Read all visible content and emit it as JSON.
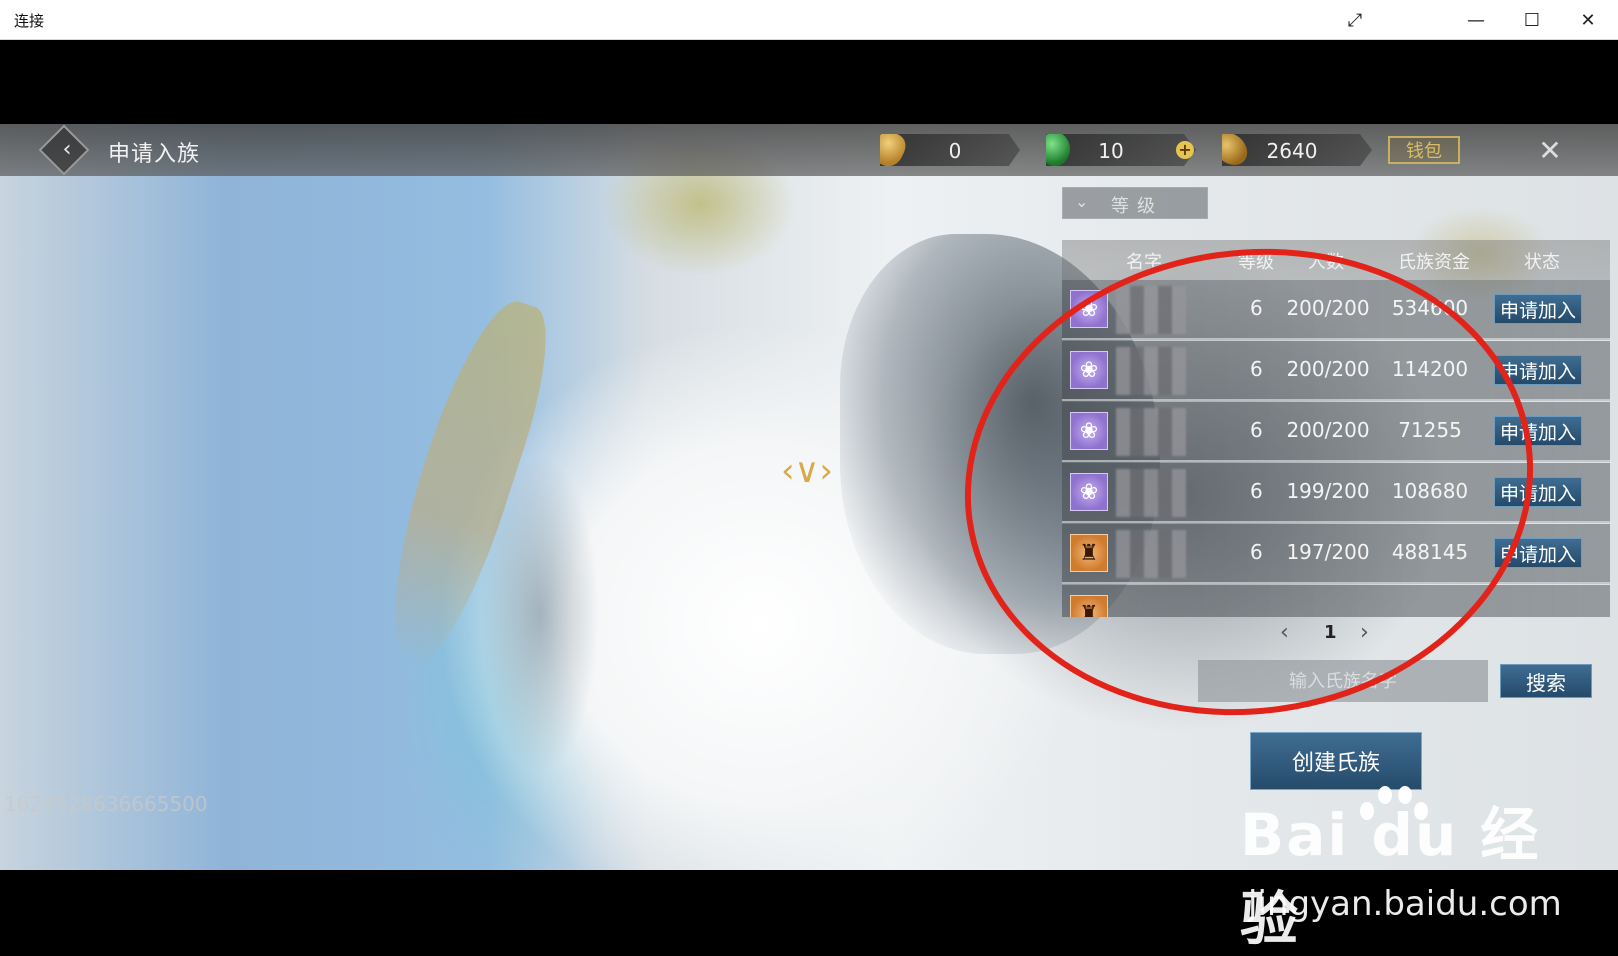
{
  "window": {
    "title": "连接"
  },
  "game": {
    "page_title": "申请入族",
    "resources": [
      {
        "icon": "gold-bell-icon",
        "value": "0"
      },
      {
        "icon": "jade-coin-icon",
        "value": "10"
      },
      {
        "icon": "copper-coin-icon",
        "value": "2640"
      }
    ],
    "wallet_label": "钱包",
    "level_filter": "等级",
    "table": {
      "headers": {
        "name": "名字",
        "level": "等级",
        "count": "人数",
        "fund": "氏族资金",
        "status": "状态"
      },
      "rows": [
        {
          "emblem": "purple",
          "level": "6",
          "count": "200/200",
          "fund": "534600",
          "action": "申请加入"
        },
        {
          "emblem": "purple",
          "level": "6",
          "count": "200/200",
          "fund": "114200",
          "action": "申请加入"
        },
        {
          "emblem": "purple",
          "level": "6",
          "count": "200/200",
          "fund": "71255",
          "action": "申请加入"
        },
        {
          "emblem": "purple",
          "level": "6",
          "count": "199/200",
          "fund": "108680",
          "action": "申请加入"
        },
        {
          "emblem": "orange",
          "level": "6",
          "count": "197/200",
          "fund": "488145",
          "action": "申请加入"
        }
      ]
    },
    "page_number": "1",
    "search": {
      "placeholder": "输入氏族名字",
      "button_label": "搜索"
    },
    "create_label": "创建氏族",
    "player_id": "1624528636665500"
  },
  "watermark": {
    "brand": "Bai du 经验",
    "url": "jingyan.baidu.com"
  },
  "colors": {
    "annotation_circle": "#e2231a",
    "button_blue": "#2f5a7e",
    "wallet_gold": "#d9bf62"
  }
}
